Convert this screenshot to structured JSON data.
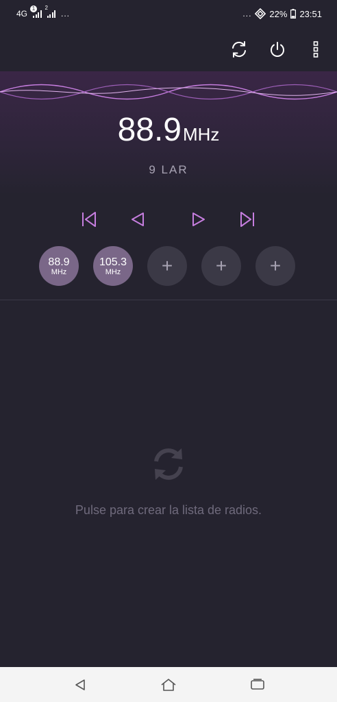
{
  "status_bar": {
    "network": "4G",
    "sim1_badge": "1",
    "sim2_badge": "2",
    "left_dots": "...",
    "right_dots": "...",
    "battery": "22%",
    "time": "23:51"
  },
  "toolbar": {
    "refresh_icon": "refresh-icon",
    "power_icon": "power-icon",
    "menu_icon": "more-vertical-icon"
  },
  "tuner": {
    "frequency": "88.9",
    "unit": "MHz",
    "station_name": "9 LAR"
  },
  "controls": {
    "skip_previous_icon": "skip-previous-icon",
    "step_back_icon": "step-back-icon",
    "step_forward_icon": "step-forward-icon",
    "skip_next_icon": "skip-next-icon"
  },
  "presets": [
    {
      "frequency": "88.9",
      "unit": "MHz"
    },
    {
      "frequency": "105.3",
      "unit": "MHz"
    },
    {
      "label": "+"
    },
    {
      "label": "+"
    },
    {
      "label": "+"
    }
  ],
  "station_list": {
    "empty_message": "Pulse para crear la lista de radios."
  },
  "colors": {
    "background": "#25232f",
    "accent": "#c77ee0",
    "preset_filled": "#7a6788",
    "preset_empty": "#3b3946"
  }
}
